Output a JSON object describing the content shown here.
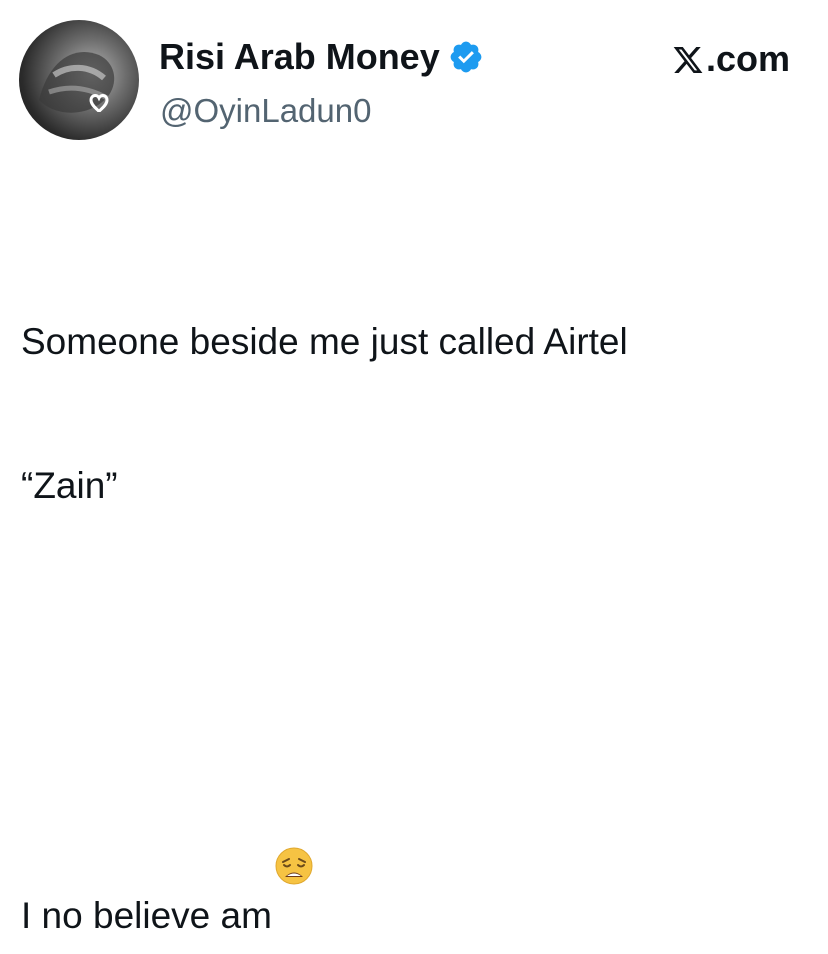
{
  "tweet": {
    "display_name": "Risi Arab Money",
    "handle": "@OyinLadun0",
    "brand": ".com",
    "text_lines": [
      "Someone beside me just called Airtel",
      "“Zain”",
      "",
      "I no believe am"
    ],
    "icons": {
      "avatar": "profile-photo",
      "verified": "verified-badge-icon",
      "brand_logo": "x-logo-icon",
      "emoji": "weary-face-emoji"
    },
    "colors": {
      "verified_blue": "#1d9bf0",
      "text": "#0f1419",
      "handle_gray": "#536471"
    }
  }
}
